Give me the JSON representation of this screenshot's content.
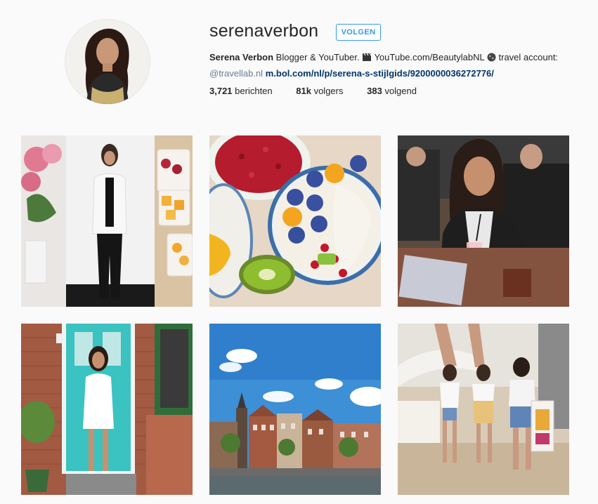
{
  "profile": {
    "username": "serenaverbon",
    "follow_label": "VOLGEN",
    "bio": {
      "name": "Serena Verbon",
      "text1": " Blogger & YouTuber. ",
      "text2": " YouTube.com/BeautylabNL ",
      "text3": " travel account:",
      "mention": "@travellab.nl",
      "link": "m.bol.com/nl/p/serena-s-stijlgids/9200000036272776/"
    },
    "stats": {
      "posts_count": "3,721",
      "posts_label": " berichten",
      "followers_count": "81k",
      "followers_label": " volgers",
      "following_count": "383",
      "following_label": " volgend"
    }
  },
  "posts": [
    {
      "subject": "collage-pink-roses-woman-black-white-outfit-fruit"
    },
    {
      "subject": "fruit-bowl-blueberries-kiwi-pomegranate"
    },
    {
      "subject": "woman-drinking-pink-smoothie-cafe"
    },
    {
      "subject": "woman-white-dress-turquoise-door"
    },
    {
      "subject": "city-canal-church-tower-blue-sky"
    },
    {
      "subject": "friends-dancing-beach-bar"
    }
  ]
}
